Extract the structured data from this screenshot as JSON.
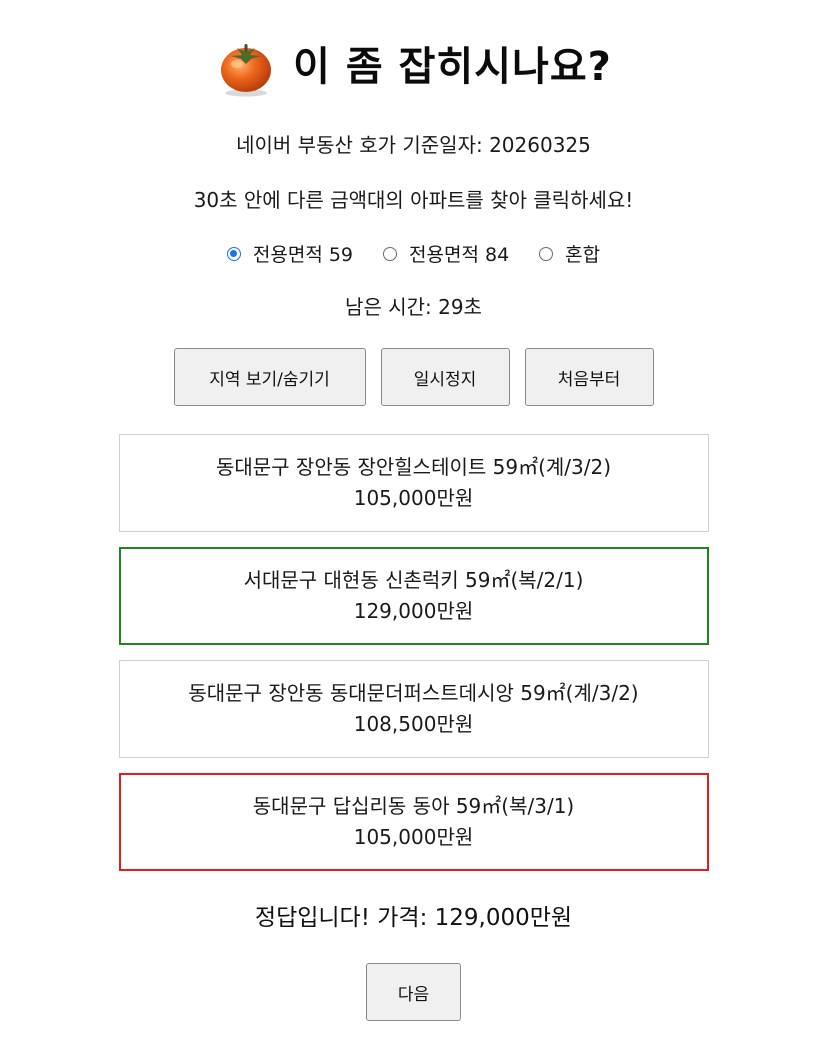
{
  "header": {
    "title": "이 좀 잡히시나요?",
    "icon": "persimmon-icon"
  },
  "info": {
    "base_date": "네이버 부동산 호가 기준일자: 20260325",
    "instruction": "30초 안에 다른 금액대의 아파트를 찾아 클릭하세요!"
  },
  "area_options": [
    {
      "label": "전용면적 59",
      "checked": true
    },
    {
      "label": "전용면적 84",
      "checked": false
    },
    {
      "label": "혼합",
      "checked": false
    }
  ],
  "timer": {
    "text": "남은 시간: 29초"
  },
  "controls": {
    "region_toggle": "지역 보기/숨기기",
    "pause": "일시정지",
    "restart": "처음부터"
  },
  "cards": [
    {
      "name": "동대문구 장안동 장안힐스테이트 59㎡(계/3/2)",
      "price": "105,000만원",
      "state": "normal"
    },
    {
      "name": "서대문구 대현동 신촌럭키 59㎡(복/2/1)",
      "price": "129,000만원",
      "state": "correct"
    },
    {
      "name": "동대문구 장안동 동대문더퍼스트데시앙 59㎡(계/3/2)",
      "price": "108,500만원",
      "state": "normal"
    },
    {
      "name": "동대문구 답십리동 동아 59㎡(복/3/1)",
      "price": "105,000만원",
      "state": "wrong"
    }
  ],
  "result": {
    "text": "정답입니다! 가격: 129,000만원"
  },
  "next": {
    "label": "다음"
  },
  "colors": {
    "correct_border": "#1a8a1a",
    "wrong_border": "#e02020",
    "radio_accent": "#1a73e8"
  }
}
